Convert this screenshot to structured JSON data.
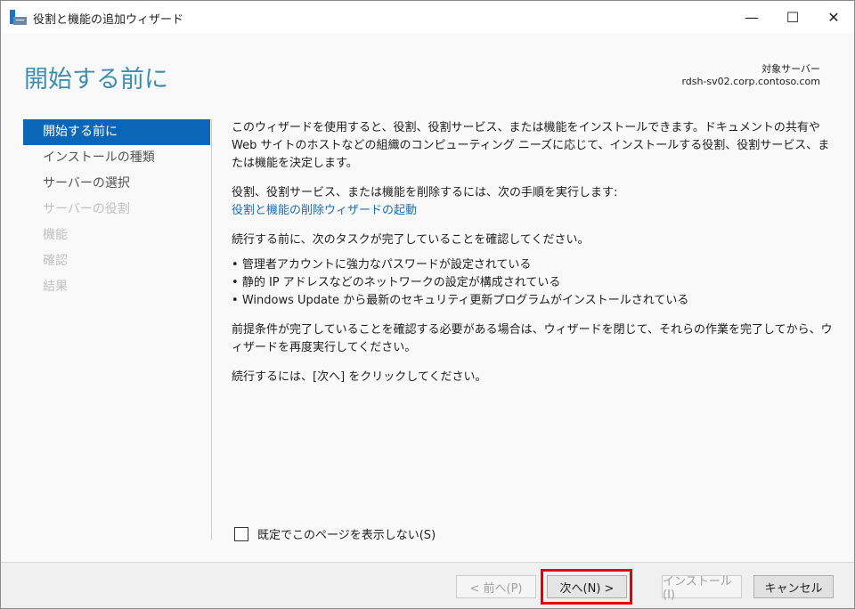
{
  "window": {
    "title": "役割と機能の追加ウィザード",
    "minimize": "—",
    "maximize": "☐",
    "close": "✕"
  },
  "header": {
    "title": "開始する前に",
    "target_label": "対象サーバー",
    "target_server": "rdsh-sv02.corp.contoso.com"
  },
  "nav": [
    "開始する前に",
    "インストールの種類",
    "サーバーの選択",
    "サーバーの役割",
    "機能",
    "確認",
    "結果"
  ],
  "content": {
    "p1": "このウィザードを使用すると、役割、役割サービス、または機能をインストールできます。ドキュメントの共有や Web サイトのホストなどの組織のコンピューティング ニーズに応じて、インストールする役割、役割サービス、または機能を決定します。",
    "p2": "役割、役割サービス、または機能を削除するには、次の手順を実行します:",
    "link": "役割と機能の削除ウィザードの起動",
    "p3": "続行する前に、次のタスクが完了していることを確認してください。",
    "bullets": [
      "管理者アカウントに強力なパスワードが設定されている",
      "静的 IP アドレスなどのネットワークの設定が構成されている",
      "Windows Update から最新のセキュリティ更新プログラムがインストールされている"
    ],
    "p4": "前提条件が完了していることを確認する必要がある場合は、ウィザードを閉じて、それらの作業を完了してから、ウィザードを再度実行してください。",
    "p5": "続行するには、[次へ] をクリックしてください。"
  },
  "checkbox": {
    "label": "既定でこのページを表示しない(S)",
    "checked": false
  },
  "buttons": {
    "prev": "< 前へ(P)",
    "next": "次へ(N) >",
    "install": "インストール(I)",
    "cancel": "キャンセル"
  }
}
